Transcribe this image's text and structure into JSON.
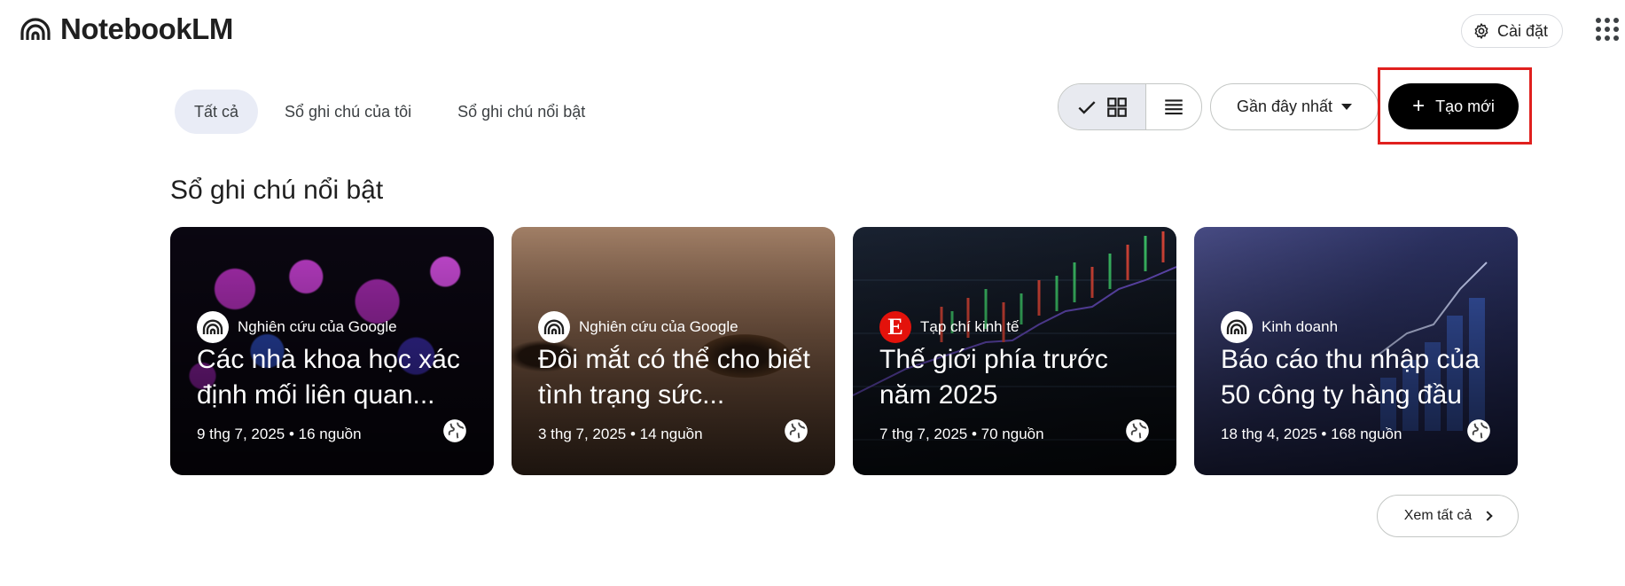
{
  "app": {
    "title": "NotebookLM"
  },
  "header": {
    "settings_label": "Cài đặt"
  },
  "filters": [
    {
      "label": "Tất cả",
      "active": true
    },
    {
      "label": "Sổ ghi chú của tôi",
      "active": false
    },
    {
      "label": "Sổ ghi chú nổi bật",
      "active": false
    }
  ],
  "view": {
    "selected": "grid"
  },
  "sort": {
    "label": "Gần đây nhất"
  },
  "create": {
    "label": "Tạo mới"
  },
  "featured": {
    "title": "Sổ ghi chú nổi bật",
    "see_all_label": "Xem tất cả",
    "cards": [
      {
        "source": "Nghiên cứu của Google",
        "title": "Các nhà khoa học xác định mối liên quan...",
        "meta": "9 thg 7, 2025 • 16 nguồn",
        "avatar": "notebooklm-logo-icon"
      },
      {
        "source": "Nghiên cứu của Google",
        "title": "Đôi mắt có thể cho biết tình trạng sức...",
        "meta": "3 thg 7, 2025 • 14 nguồn",
        "avatar": "notebooklm-logo-icon"
      },
      {
        "source": "Tạp chí kinh tế",
        "title": "Thế giới phía trước năm 2025",
        "meta": "7 thg 7, 2025 • 70 nguồn",
        "avatar": "E"
      },
      {
        "source": "Kinh doanh",
        "title": "Báo cáo thu nhập của 50 công ty hàng đầu",
        "meta": "18 thg 4, 2025 • 168 nguồn",
        "avatar": "notebooklm-logo-icon"
      }
    ]
  },
  "colors": {
    "primary_button": "#000000",
    "active_chip": "#e9ecf6",
    "highlight": "#e0201e"
  }
}
